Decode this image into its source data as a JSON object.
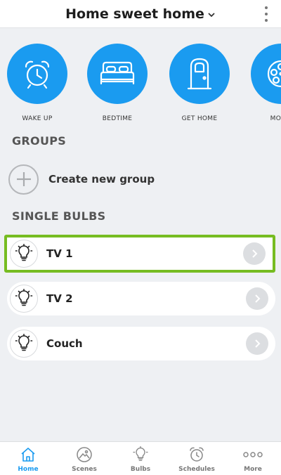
{
  "header": {
    "title": "Home sweet home"
  },
  "scenes": [
    {
      "label": "WAKE UP",
      "icon": "alarm-clock-icon"
    },
    {
      "label": "BEDTIME",
      "icon": "bed-icon"
    },
    {
      "label": "GET HOME",
      "icon": "door-icon"
    },
    {
      "label": "MOVIE",
      "icon": "film-reel-icon"
    }
  ],
  "groups": {
    "title": "GROUPS",
    "create_label": "Create new group"
  },
  "bulbs": {
    "title": "SINGLE BULBS",
    "items": [
      {
        "label": "TV 1"
      },
      {
        "label": "TV 2"
      },
      {
        "label": "Couch"
      }
    ]
  },
  "tabs": [
    {
      "label": "Home",
      "icon": "home-icon"
    },
    {
      "label": "Scenes",
      "icon": "scenes-icon"
    },
    {
      "label": "Bulbs",
      "icon": "bulb-icon"
    },
    {
      "label": "Schedules",
      "icon": "schedule-clock-icon"
    },
    {
      "label": "More",
      "icon": "more-dots-icon"
    }
  ],
  "colors": {
    "accent": "#1a9bf0",
    "highlight": "#76bc21",
    "background": "#eef0f3"
  }
}
